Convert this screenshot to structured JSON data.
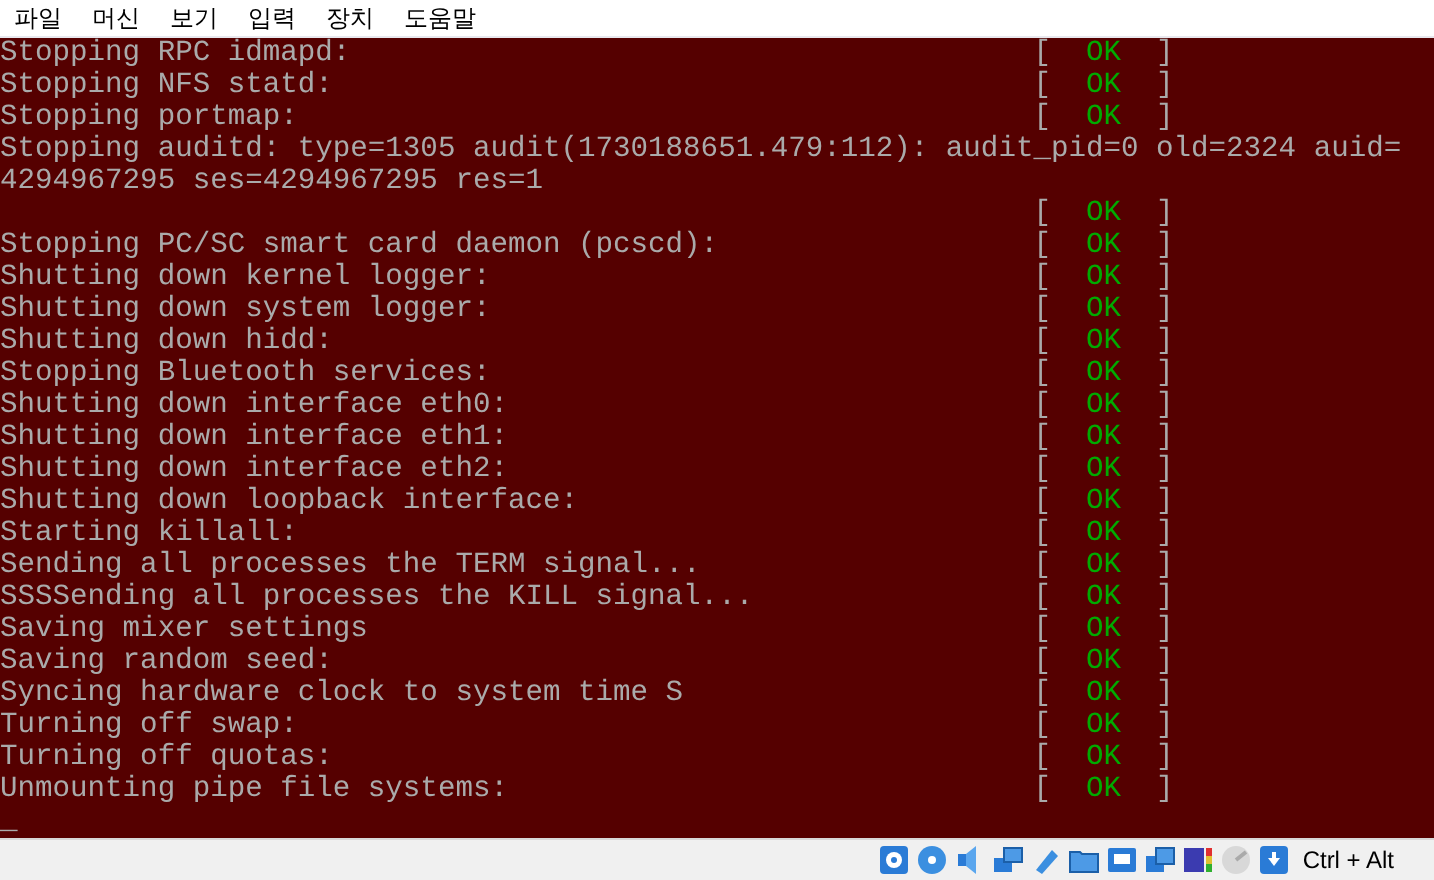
{
  "menu": [
    "파일",
    "머신",
    "보기",
    "입력",
    "장치",
    "도움말"
  ],
  "console": {
    "lines": [
      {
        "text": "Stopping RPC idmapd:",
        "status": {
          "open": "[",
          "word": "OK",
          "close": "]"
        }
      },
      {
        "text": "Stopping NFS statd:",
        "status": {
          "open": "[",
          "word": "OK",
          "close": "]"
        }
      },
      {
        "text": "Stopping portmap:",
        "status": {
          "open": "[",
          "word": "OK",
          "close": "]"
        }
      },
      {
        "text": "Stopping auditd: type=1305 audit(1730188651.479:112): audit_pid=0 old=2324 auid="
      },
      {
        "text": "4294967295 ses=4294967295 res=1"
      },
      {
        "status": {
          "open": "[",
          "word": "OK",
          "close": "]"
        }
      },
      {
        "text": "Stopping PC/SC smart card daemon (pcscd):",
        "status": {
          "open": "[",
          "word": "OK",
          "close": "]"
        }
      },
      {
        "text": "Shutting down kernel logger:",
        "status": {
          "open": "[",
          "word": "OK",
          "close": "]"
        }
      },
      {
        "text": "Shutting down system logger:",
        "status": {
          "open": "[",
          "word": "OK",
          "close": "]"
        }
      },
      {
        "text": "Shutting down hidd:",
        "status": {
          "open": "[",
          "word": "OK",
          "close": "]"
        }
      },
      {
        "text": "Stopping Bluetooth services:",
        "status": {
          "open": "[",
          "word": "OK",
          "close": "]"
        }
      },
      {
        "text": "Shutting down interface eth0:",
        "status": {
          "open": "[",
          "word": "OK",
          "close": "]"
        }
      },
      {
        "text": "Shutting down interface eth1:",
        "status": {
          "open": "[",
          "word": "OK",
          "close": "]"
        }
      },
      {
        "text": "Shutting down interface eth2:",
        "status": {
          "open": "[",
          "word": "OK",
          "close": "]"
        }
      },
      {
        "text": "Shutting down loopback interface:",
        "status": {
          "open": "[",
          "word": "OK",
          "close": "]"
        }
      },
      {
        "text": "Starting killall:",
        "status": {
          "open": "[",
          "word": "OK",
          "close": "]"
        }
      },
      {
        "text": "Sending all processes the TERM signal...",
        "status": {
          "open": "[",
          "word": "OK",
          "close": "]"
        }
      },
      {
        "text": "SSSSending all processes the KILL signal...",
        "status": {
          "open": "[",
          "word": "OK",
          "close": "]"
        }
      },
      {
        "text": "Saving mixer settings",
        "status": {
          "open": "[",
          "word": "OK",
          "close": "]"
        }
      },
      {
        "text": "Saving random seed:",
        "status": {
          "open": "[",
          "word": "OK",
          "close": "]"
        }
      },
      {
        "text": "Syncing hardware clock to system time S",
        "status": {
          "open": "[",
          "word": "OK",
          "close": "]"
        }
      },
      {
        "text": "Turning off swap:",
        "status": {
          "open": "[",
          "word": "OK",
          "close": "]"
        }
      },
      {
        "text": "Turning off quotas:",
        "status": {
          "open": "[",
          "word": "OK",
          "close": "]"
        }
      },
      {
        "text": "Unmounting pipe file systems:",
        "status": {
          "open": "[",
          "word": "OK",
          "close": "]"
        }
      },
      {
        "text": "_"
      }
    ]
  },
  "status_bar": {
    "host_key": "Ctrl + Alt"
  }
}
